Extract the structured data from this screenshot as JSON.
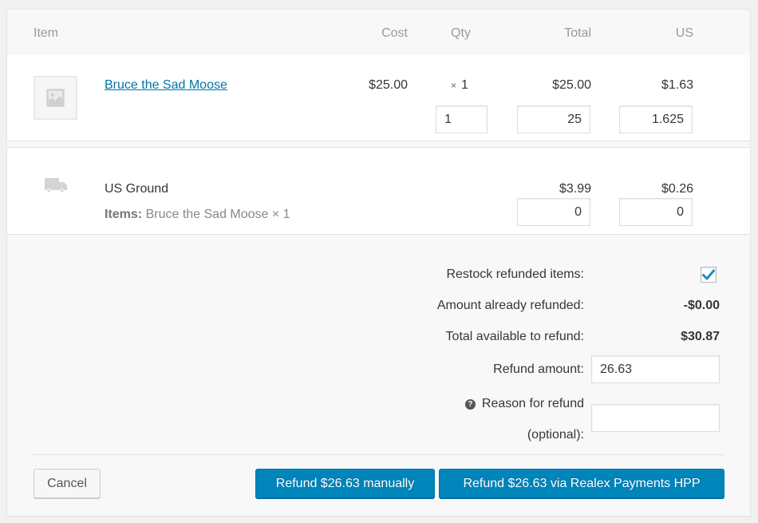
{
  "table": {
    "headers": {
      "item": "Item",
      "cost": "Cost",
      "qty": "Qty",
      "total": "Total",
      "tax": "US"
    },
    "product": {
      "name": "Bruce the Sad Moose",
      "cost": "$25.00",
      "qty_prefix": "×",
      "qty": "1",
      "total": "$25.00",
      "tax": "$1.63",
      "refund_qty": "1",
      "refund_total": "25",
      "refund_tax": "1.625",
      "thumbnail_icon": "image-placeholder-icon"
    },
    "shipping": {
      "name": "US Ground",
      "items_label": "Items:",
      "items_value": "Bruce the Sad Moose × 1",
      "total": "$3.99",
      "tax": "$0.26",
      "refund_total": "0",
      "refund_tax": "0",
      "icon": "truck-icon"
    }
  },
  "refund": {
    "restock_label": "Restock refunded items:",
    "restock_checked": true,
    "already_refunded_label": "Amount already refunded:",
    "already_refunded_value": "-$0.00",
    "available_label": "Total available to refund:",
    "available_value": "$30.87",
    "amount_label": "Refund amount:",
    "amount_value": "26.63",
    "reason_label_line1": "Reason for refund",
    "reason_label_line2": "(optional):",
    "reason_value": "",
    "help_icon": "?"
  },
  "actions": {
    "cancel": "Cancel",
    "refund_manual": "Refund $26.63 manually",
    "refund_gateway": "Refund $26.63 via Realex Payments HPP"
  },
  "colors": {
    "primary": "#0085ba",
    "link": "#0073aa",
    "checkmark": "#1e8cbe"
  }
}
